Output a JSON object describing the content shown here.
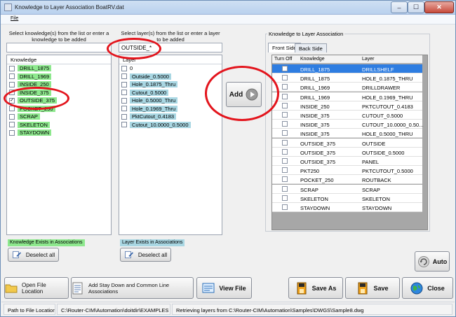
{
  "window": {
    "title": "Knowledge to Layer Association BoatRV.dat",
    "minimize": "–",
    "maximize": "☐",
    "close": "✕"
  },
  "menu": {
    "file": "File"
  },
  "knowledge_panel": {
    "instruction": "Select knowledge(s) from the list or enter a knowledge to be added",
    "search_value": "",
    "header": "Knowledge",
    "items": [
      {
        "label": "DRILL_1875",
        "checked": false,
        "exists": true
      },
      {
        "label": "DRILL_1969",
        "checked": false,
        "exists": true
      },
      {
        "label": "INSIDE_250",
        "checked": false,
        "exists": true
      },
      {
        "label": "INSIDE_375",
        "checked": false,
        "exists": true
      },
      {
        "label": "OUTSIDE_375",
        "checked": true,
        "exists": true
      },
      {
        "label": "POCKET_250",
        "checked": false,
        "exists": true
      },
      {
        "label": "SCRAP",
        "checked": false,
        "exists": true
      },
      {
        "label": "SKELETON",
        "checked": false,
        "exists": true
      },
      {
        "label": "STAYDOWN",
        "checked": false,
        "exists": true
      }
    ],
    "legend": "Knowledge Exists in Associations",
    "deselect_label": "Deselect all"
  },
  "layer_panel": {
    "instruction": "Select layer(s) from the list or enter a layer to be added",
    "search_value": "OUTSIDE_*",
    "header": "Layer",
    "items": [
      {
        "label": "0",
        "checked": false,
        "exists": false
      },
      {
        "label": "Outside_0.5000",
        "checked": false,
        "exists": true
      },
      {
        "label": "Hole_0.1875_Thru",
        "checked": false,
        "exists": true
      },
      {
        "label": "Cutout_0.5000",
        "checked": false,
        "exists": true
      },
      {
        "label": "Hole_0.5000_Thru",
        "checked": false,
        "exists": true
      },
      {
        "label": "Hole_0.1969_Thru",
        "checked": false,
        "exists": true
      },
      {
        "label": "PktCutout_0.4183",
        "checked": false,
        "exists": true
      },
      {
        "label": "Cutout_10.0000_0.5000",
        "checked": false,
        "exists": true
      }
    ],
    "legend": "Layer Exists in Associations",
    "deselect_label": "Deselect all"
  },
  "add_button": {
    "label": "Add"
  },
  "association": {
    "group_title": "Knowledge to Layer Association",
    "tabs": [
      "Front Side",
      "Back Side"
    ],
    "columns": [
      "Turn Off",
      "Knowledge",
      "Layer"
    ],
    "rows": [
      {
        "knowledge": "DRILL_1875",
        "layer": "DRILLSHELF",
        "selected": true
      },
      {
        "knowledge": "DRILL_1875",
        "layer": "HOLE_0.1875_THRU"
      },
      {
        "knowledge": "DRILL_1969",
        "layer": "DRILLDRAWER"
      },
      {
        "knowledge": "DRILL_1969",
        "layer": "HOLE_0.1969_THRU"
      },
      {
        "knowledge": "INSIDE_250",
        "layer": "PKTCUTOUT_0.4183"
      },
      {
        "knowledge": "INSIDE_375",
        "layer": "CUTOUT_0.5000"
      },
      {
        "knowledge": "INSIDE_375",
        "layer": "CUTOUT_10.0000_0.50..."
      },
      {
        "knowledge": "INSIDE_375",
        "layer": "HOLE_0.5000_THRU"
      },
      {
        "knowledge": "OUTSIDE_375",
        "layer": "OUTSIDE"
      },
      {
        "knowledge": "OUTSIDE_375",
        "layer": "OUTSIDE_0.5000"
      },
      {
        "knowledge": "OUTSIDE_375",
        "layer": "PANEL"
      },
      {
        "knowledge": "PKT250",
        "layer": "PKTCUTOUT_0.5000"
      },
      {
        "knowledge": "POCKET_250",
        "layer": "ROUTBACK"
      },
      {
        "knowledge": "SCRAP",
        "layer": "SCRAP"
      },
      {
        "knowledge": "SKELETON",
        "layer": "SKELETON"
      },
      {
        "knowledge": "STAYDOWN",
        "layer": "STAYDOWN"
      }
    ],
    "auto_label": "Auto"
  },
  "toolbar": {
    "open_file_location": "Open File Location",
    "add_stay_down": "Add Stay Down and Common Line Associations",
    "view_file": "View File",
    "save_as": "Save As",
    "save": "Save",
    "close": "Close"
  },
  "status": {
    "path_label": "Path to File Location",
    "path_value": "C:\\Router-CIM\\Automation\\doitdir\\EXAMPLES",
    "message": "Retrieving layers from C:\\Router-CIM\\Automation\\Samples\\DWGS\\Sample8.dwg"
  },
  "colors": {
    "knowledge_exists": "#8ee88e",
    "layer_exists": "#a9d7e3",
    "selection": "#2e7de1",
    "annotation_red": "#e3141c"
  }
}
